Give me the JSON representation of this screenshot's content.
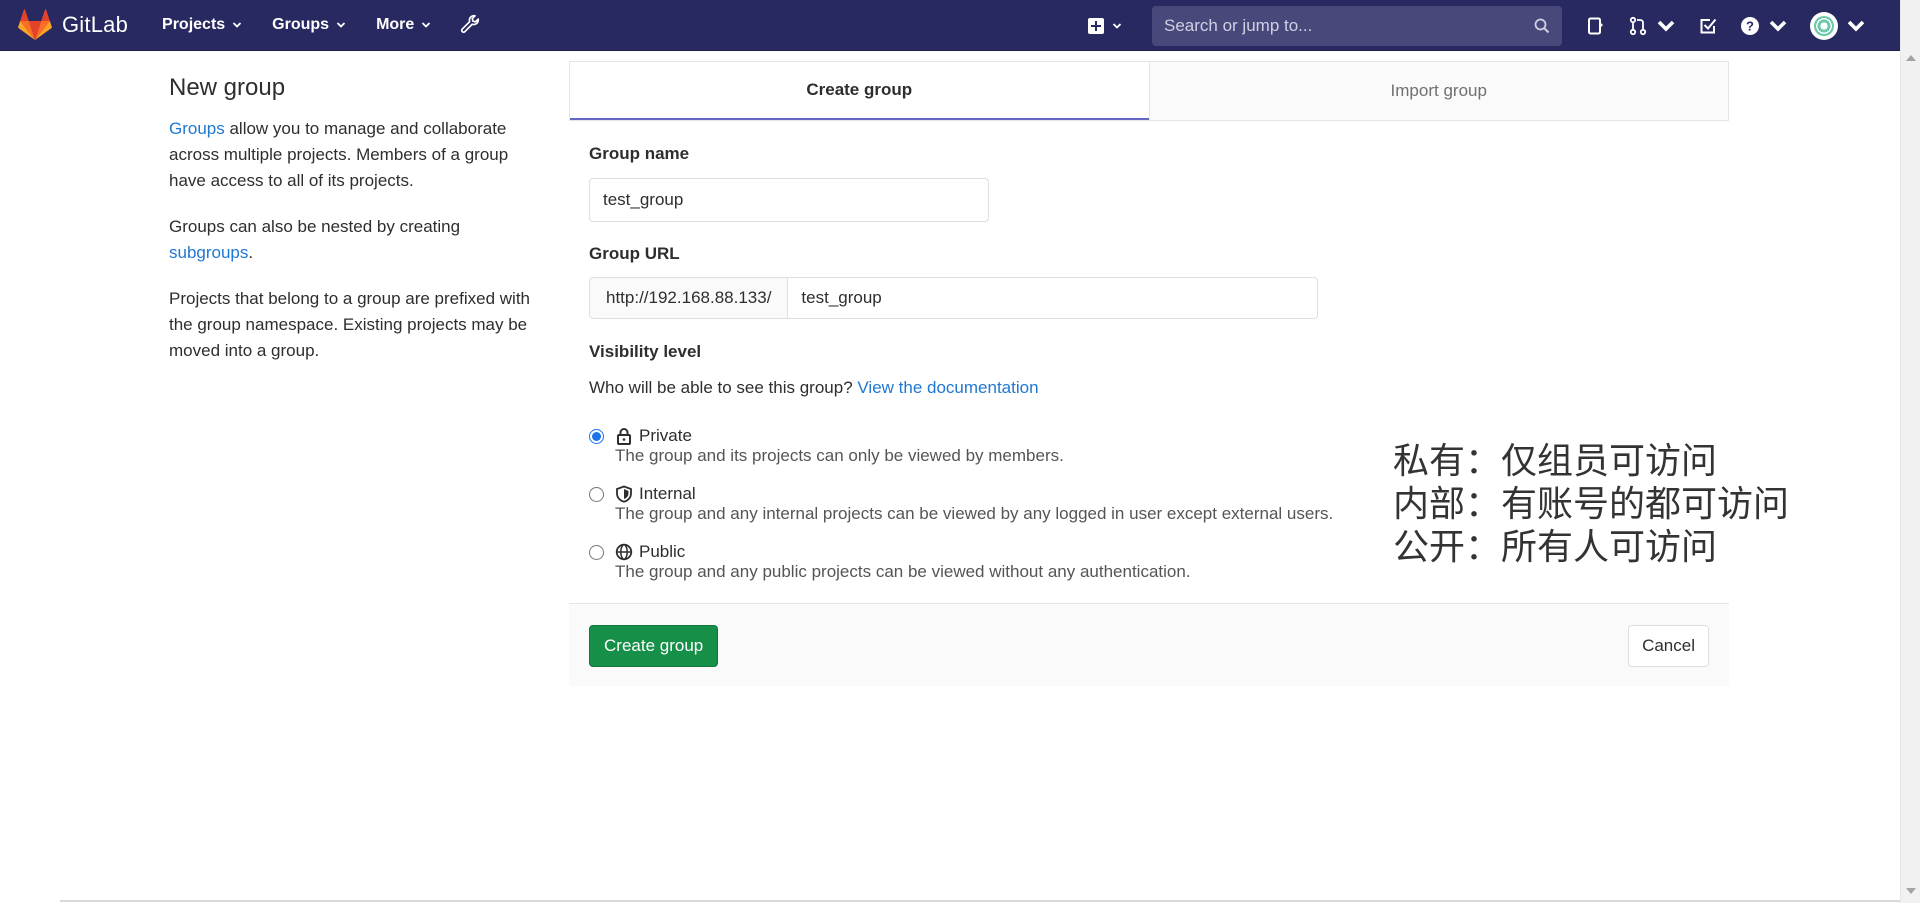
{
  "navbar": {
    "brand": "GitLab",
    "menu": [
      {
        "label": "Projects"
      },
      {
        "label": "Groups"
      },
      {
        "label": "More"
      }
    ],
    "search_placeholder": "Search or jump to...",
    "colors": {
      "background": "#292961",
      "accent": "#fc6d26"
    }
  },
  "sidebar": {
    "title": "New group",
    "para1_link": "Groups",
    "para1_rest": " allow you to manage and collaborate across multiple projects. Members of a group have access to all of its projects.",
    "para2_text": "Groups can also be nested by creating ",
    "para2_link": "subgroups",
    "para2_end": ".",
    "para3": "Projects that belong to a group are prefixed with the group namespace. Existing projects may be moved into a group."
  },
  "tabs": [
    {
      "label": "Create group",
      "active": true
    },
    {
      "label": "Import group",
      "active": false
    }
  ],
  "form": {
    "group_name_label": "Group name",
    "group_name_value": "test_group",
    "group_url_label": "Group URL",
    "group_url_prefix": "http://192.168.88.133/",
    "group_url_value": "test_group",
    "visibility_label": "Visibility level",
    "visibility_question": "Who will be able to see this group?",
    "visibility_link": "View the documentation",
    "options": [
      {
        "title": "Private",
        "description": "The group and its projects can only be viewed by members.",
        "icon": "lock-icon",
        "checked": true
      },
      {
        "title": "Internal",
        "description": "The group and any internal projects can be viewed by any logged in user except external users.",
        "icon": "shield-icon",
        "checked": false
      },
      {
        "title": "Public",
        "description": "The group and any public projects can be viewed without any authentication.",
        "icon": "globe-icon",
        "checked": false
      }
    ]
  },
  "annotation": {
    "line1": "私有：仅组员可访问",
    "line2": "内部：有账号的都可访问",
    "line3": "公开：所有人可访问"
  },
  "actions": {
    "create_label": "Create group",
    "cancel_label": "Cancel",
    "create_color": "#168f48"
  }
}
